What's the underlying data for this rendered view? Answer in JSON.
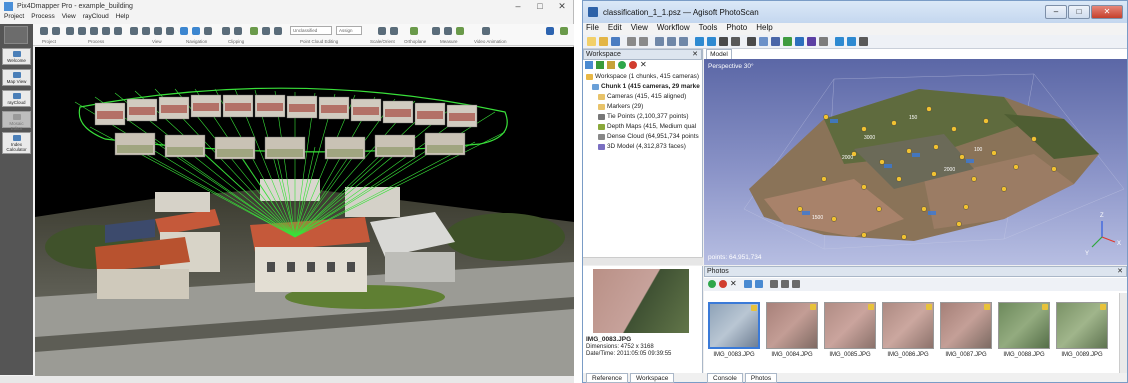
{
  "left": {
    "title": "Pix4Dmapper Pro - example_building",
    "window_controls": [
      "–",
      "□",
      "✕"
    ],
    "menu": [
      "Project",
      "Process",
      "View",
      "rayCloud",
      "Help"
    ],
    "ribbon_groups": [
      "Project",
      "Process",
      "View",
      "Navigation",
      "Clipping",
      "Point Cloud Editing",
      "Scale/Orient",
      "Orthoplane",
      "Measure",
      "Video Animation"
    ],
    "ribbon_selects": [
      "Unclassified",
      "Assign"
    ],
    "sidebar": [
      {
        "label": "Welcome",
        "dim": false
      },
      {
        "label": "Map View",
        "dim": false
      },
      {
        "label": "rayCloud",
        "dim": false
      },
      {
        "label": "Mosaic Editor",
        "dim": true
      },
      {
        "label": "Index Calculator",
        "dim": false
      }
    ]
  },
  "right": {
    "title": "classification_1_1.psz — Agisoft PhotoScan",
    "menu": [
      "File",
      "Edit",
      "View",
      "Workflow",
      "Tools",
      "Photo",
      "Help"
    ],
    "workspace_header": "Workspace",
    "tree": [
      {
        "text": "Workspace (1 chunks, 415 cameras)",
        "indent": 0,
        "bold": false,
        "color": "#e8b746"
      },
      {
        "text": "Chunk 1 (415 cameras, 29 markers",
        "indent": 1,
        "bold": true,
        "color": "#6aa0d8"
      },
      {
        "text": "Cameras (415, 415 aligned)",
        "indent": 2,
        "bold": false,
        "color": "#e8c36a"
      },
      {
        "text": "Markers (29)",
        "indent": 2,
        "bold": false,
        "color": "#e8c36a"
      },
      {
        "text": "Tie Points (2,100,377 points)",
        "indent": 2,
        "bold": false,
        "color": "#777777"
      },
      {
        "text": "Depth Maps (415, Medium qual",
        "indent": 2,
        "bold": false,
        "color": "#8aa83a"
      },
      {
        "text": "Dense Cloud (64,951,734 points",
        "indent": 2,
        "bold": false,
        "color": "#888888"
      },
      {
        "text": "3D Model (4,312,873 faces)",
        "indent": 2,
        "bold": false,
        "color": "#7a6fc2"
      }
    ],
    "model_tab": "Model",
    "perspective": "Perspective 30°",
    "points_readout": "points: 64,951,734",
    "photos_header": "Photos",
    "selected_photo": {
      "name": "IMG_0083.JPG",
      "dimensions": "Dimensions: 4752 x 3168",
      "datetime": "Date/Time: 2011:05:05 09:39:55"
    },
    "photos": [
      "IMG_0083.JPG",
      "IMG_0084.JPG",
      "IMG_0085.JPG",
      "IMG_0086.JPG",
      "IMG_0087.JPG",
      "IMG_0088.JPG",
      "IMG_0089.JPG"
    ],
    "bottom_tabs_left": [
      "Reference",
      "Workspace"
    ],
    "bottom_tabs_right": [
      "Console",
      "Photos"
    ],
    "axis_labels": [
      "Z",
      "X",
      "Y"
    ],
    "marker_labels": [
      "150",
      "3000",
      "2000",
      "2000",
      "1500",
      "100"
    ]
  }
}
